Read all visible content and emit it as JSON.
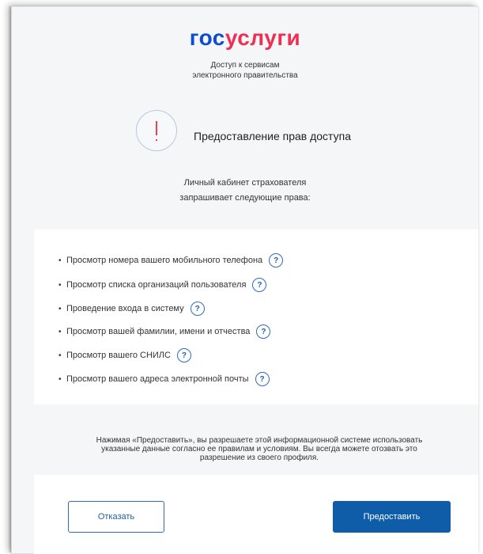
{
  "logo": {
    "part1": "гос",
    "part2": "услуги"
  },
  "subtitle": {
    "line1": "Доступ к сервисам",
    "line2": "электронного правительства"
  },
  "heading": "Предоставление прав доступа",
  "request": {
    "line1": "Личный кабинет страхователя",
    "line2": "запрашивает следующие права:"
  },
  "permissions": [
    "Просмотр номера вашего мобильного телефона",
    "Просмотр списка организаций пользователя",
    "Проведение входа в систему",
    "Просмотр вашей фамилии, имени и отчества",
    "Просмотр вашего СНИЛС",
    "Просмотр вашего адреса электронной почты"
  ],
  "bullet": "•",
  "help_glyph": "?",
  "notice": {
    "line1": "Нажимая «Предоставить», вы разрешаете этой информационной системе использовать",
    "line2": "указанные данные согласно ее правилам и условиям. Вы всегда можете отозвать это",
    "line3": "разрешение из своего профиля."
  },
  "buttons": {
    "cancel": "Отказать",
    "grant": "Предоставить"
  },
  "colors": {
    "brand_blue": "#0d4cd3",
    "brand_red": "#ee2f53",
    "primary_button": "#0f5ca8",
    "alert": "#ee3f58"
  }
}
